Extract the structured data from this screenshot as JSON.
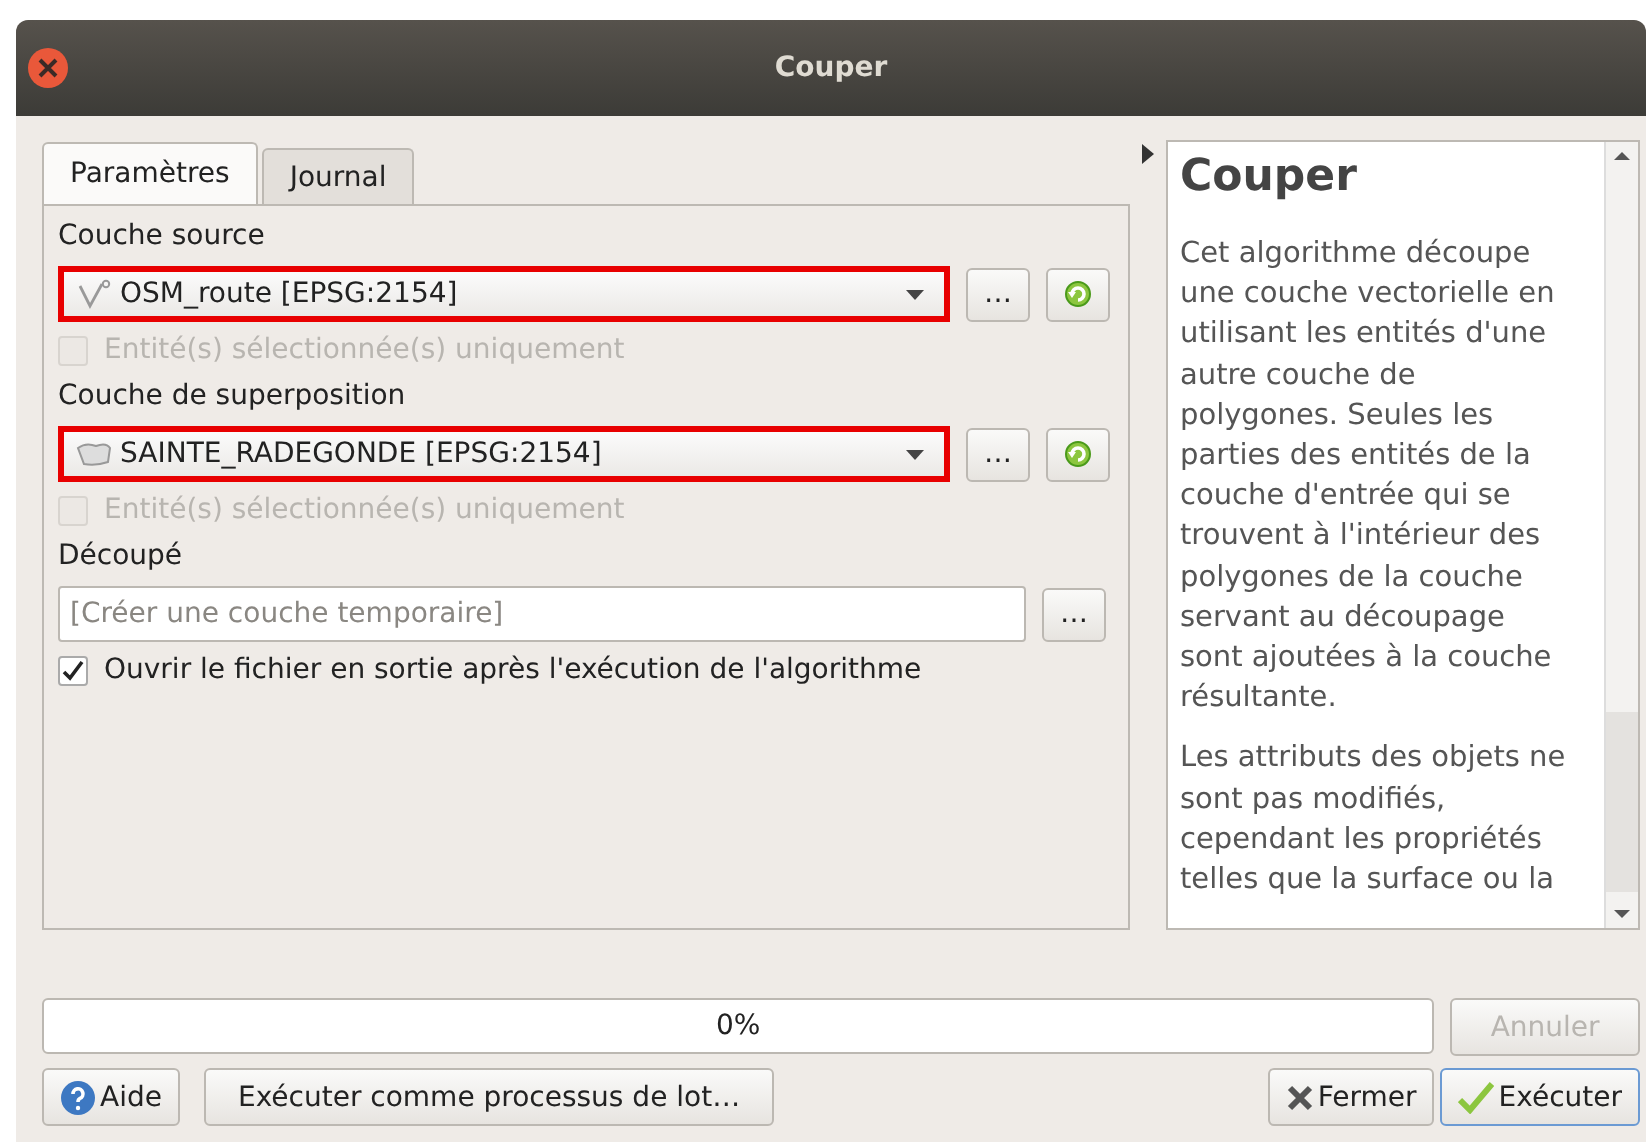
{
  "window": {
    "title": "Couper"
  },
  "tabs": [
    {
      "label": "Paramètres",
      "selected": true
    },
    {
      "label": "Journal",
      "selected": false
    }
  ],
  "parameters": [
    {
      "kind": "line_layer",
      "label": "Couche source",
      "value": "OSM_route [EPSG:2154]",
      "browse_label": "…",
      "highlighted": true,
      "checkbox": {
        "label": "Entité(s) sélectionnée(s) uniquement",
        "checked": false,
        "disabled": true
      }
    },
    {
      "kind": "polygon_layer",
      "label": "Couche de superposition",
      "value": "SAINTE_RADEGONDE [EPSG:2154]",
      "browse_label": "…",
      "highlighted": true,
      "checkbox": {
        "label": "Entité(s) sélectionnée(s) uniquement",
        "checked": false,
        "disabled": true
      }
    },
    {
      "kind": "output",
      "label": "Découpé",
      "placeholder": "[Créer une couche temporaire]",
      "browse_label": "…",
      "checkbox": {
        "label": "Ouvrir le fichier en sortie après l'exécution de l'algorithme",
        "checked": true,
        "disabled": false
      }
    }
  ],
  "help": {
    "title": "Couper",
    "paragraphs": [
      "Cet algorithme découpe une couche vectorielle en utilisant les entités d'une autre couche de polygones. Seules les parties des entités de la couche d'entrée qui se trouvent à l'intérieur des polygones de la couche servant au découpage sont ajoutées à la couche résultante.",
      "Les attributs des objets ne sont pas modifiés, cependant les propriétés telles que la surface ou la"
    ]
  },
  "progress": {
    "text": "0%"
  },
  "cancel_button": {
    "label": "Annuler",
    "disabled": true
  },
  "buttons": [
    {
      "kind": "help",
      "label": "Aide",
      "default": false
    },
    {
      "kind": "batch",
      "label": "Exécuter comme processus de lot…",
      "default": false
    },
    {
      "kind": "close",
      "label": "Fermer",
      "default": false
    },
    {
      "kind": "run",
      "label": "Exécuter",
      "default": true
    }
  ]
}
